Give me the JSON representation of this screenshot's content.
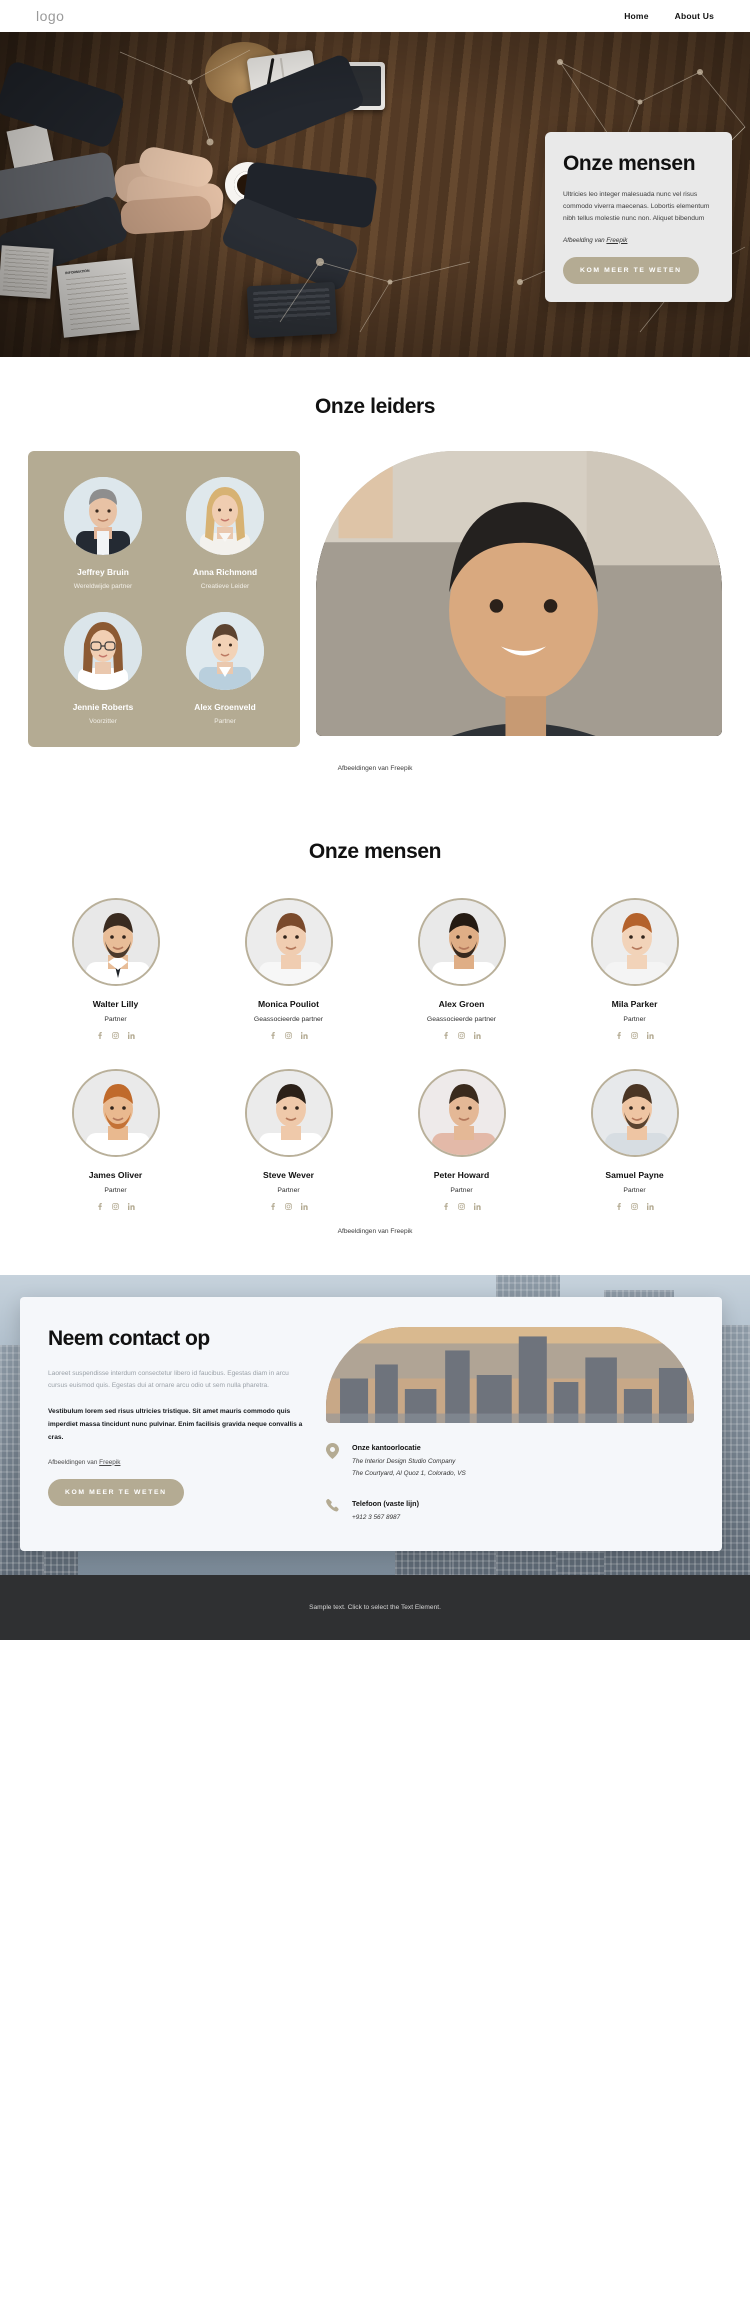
{
  "header": {
    "logo": "logo",
    "nav": [
      {
        "label": "Home"
      },
      {
        "label": "About Us"
      }
    ]
  },
  "hero": {
    "title": "Onze mensen",
    "body": "Ultricies leo integer malesuada nunc vel risus commodo viverra maecenas. Lobortis elementum nibh tellus molestie nunc non. Aliquet bibendum",
    "credit_prefix": "Afbeelding van ",
    "credit_link": "Freepik",
    "button": "KOM MEER TE WETEN"
  },
  "leaders": {
    "title": "Onze leiders",
    "caption": "Afbeeldingen van Freepik",
    "items": [
      {
        "name": "Jeffrey Bruin",
        "role": "Wereldwijde partner"
      },
      {
        "name": "Anna Richmond",
        "role": "Creatieve Leider"
      },
      {
        "name": "Jennie Roberts",
        "role": "Voorzitter"
      },
      {
        "name": "Alex Groenveld",
        "role": "Partner"
      }
    ]
  },
  "people": {
    "title": "Onze mensen",
    "caption": "Afbeeldingen van Freepik",
    "social_icons": [
      "facebook-icon",
      "instagram-icon",
      "linkedin-icon"
    ],
    "items": [
      {
        "name": "Walter Lilly",
        "role": "Partner"
      },
      {
        "name": "Monica Pouliot",
        "role": "Geassocieerde partner"
      },
      {
        "name": "Alex Groen",
        "role": "Geassocieerde partner"
      },
      {
        "name": "Mila Parker",
        "role": "Partner"
      },
      {
        "name": "James Oliver",
        "role": "Partner"
      },
      {
        "name": "Steve Wever",
        "role": "Partner"
      },
      {
        "name": "Peter Howard",
        "role": "Partner"
      },
      {
        "name": "Samuel Payne",
        "role": "Partner"
      }
    ]
  },
  "contact": {
    "title": "Neem contact op",
    "muted": "Laoreet suspendisse interdum consectetur libero id faucibus. Egestas diam in arcu cursus euismod quis. Egestas dui at ornare arcu odio ut sem nulla pharetra.",
    "strong": "Vestibulum lorem sed risus ultricies tristique. Sit amet mauris commodo quis imperdiet massa tincidunt nunc pulvinar. Enim facilisis gravida neque convallis a cras.",
    "credit_prefix": "Afbeeldingen van ",
    "credit_link": "Freepik",
    "button": "KOM MEER TE WETEN",
    "office": {
      "title": "Onze kantoorlocatie",
      "line1": "The Interior Design Studio Company",
      "line2": "The Courtyard, Al Quoz 1, Colorado,  VS"
    },
    "phone": {
      "title": "Telefoon (vaste lijn)",
      "value": "+912 3 567 8987"
    }
  },
  "footer": {
    "text": "Sample text. Click to select the Text Element."
  },
  "colors": {
    "accent": "#b4ab93",
    "footer_bg": "#2f3032",
    "card_bg": "#e9e9e9",
    "contact_card_bg": "#f5f7fa"
  }
}
